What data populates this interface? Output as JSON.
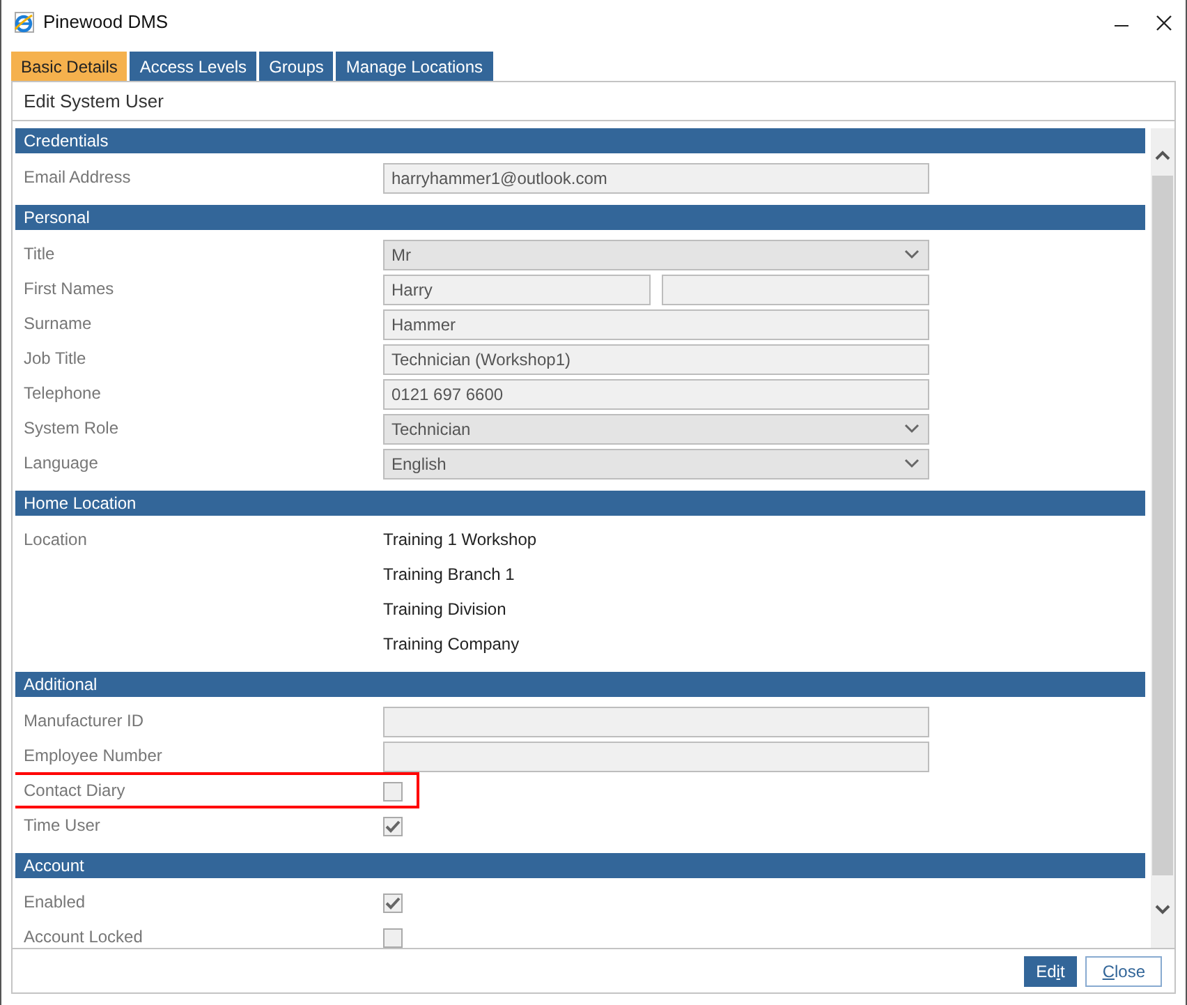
{
  "window": {
    "title": "Pinewood DMS"
  },
  "tabs": [
    {
      "label": "Basic Details",
      "selected": true
    },
    {
      "label": "Access Levels",
      "selected": false
    },
    {
      "label": "Groups",
      "selected": false
    },
    {
      "label": "Manage Locations",
      "selected": false
    }
  ],
  "panel_title": "Edit System User",
  "sections": [
    {
      "title": "Credentials",
      "rows": [
        {
          "label": "Email Address",
          "kind": "text",
          "value": "harryhammer1@outlook.com",
          "highlighted": false
        }
      ]
    },
    {
      "title": "Personal",
      "rows": [
        {
          "label": "Title",
          "kind": "select",
          "value": "Mr",
          "highlighted": false
        },
        {
          "label": "First Names",
          "kind": "text_pair",
          "values": [
            "Harry"
          ],
          "highlighted": false
        },
        {
          "label": "Surname",
          "kind": "text",
          "value": "Hammer",
          "highlighted": false
        },
        {
          "label": "Job Title",
          "kind": "text",
          "value": "Technician (Workshop1)",
          "highlighted": false
        },
        {
          "label": "Telephone",
          "kind": "text",
          "value": "0121 697 6600",
          "highlighted": false
        },
        {
          "label": "System Role",
          "kind": "select",
          "value": "Technician",
          "highlighted": false
        },
        {
          "label": "Language",
          "kind": "select",
          "value": "English",
          "highlighted": false
        }
      ]
    },
    {
      "title": "Home Location",
      "rows": [
        {
          "label": "Location",
          "kind": "lines",
          "values": [
            "Training 1 Workshop",
            "Training Branch 1",
            "Training Division",
            "Training Company"
          ],
          "highlighted": false
        }
      ]
    },
    {
      "title": "Additional",
      "rows": [
        {
          "label": "Manufacturer ID",
          "kind": "text",
          "highlighted": false
        },
        {
          "label": "Employee Number",
          "kind": "text",
          "highlighted": false
        },
        {
          "label": "Contact Diary",
          "kind": "checkbox",
          "checked": false,
          "highlighted": true
        },
        {
          "label": "Time User",
          "kind": "checkbox",
          "checked": true,
          "highlighted": false
        }
      ]
    },
    {
      "title": "Account",
      "rows": [
        {
          "label": "Enabled",
          "kind": "checkbox",
          "checked": true,
          "highlighted": false
        },
        {
          "label": "Account Locked",
          "kind": "checkbox",
          "checked": false,
          "highlighted": false
        }
      ]
    }
  ],
  "buttons": [
    {
      "kind": "primary",
      "text_before": "Ed",
      "access_key": "i",
      "text_after": "t"
    },
    {
      "kind": "secondary",
      "access_key": "C",
      "text_after": "lose"
    }
  ]
}
